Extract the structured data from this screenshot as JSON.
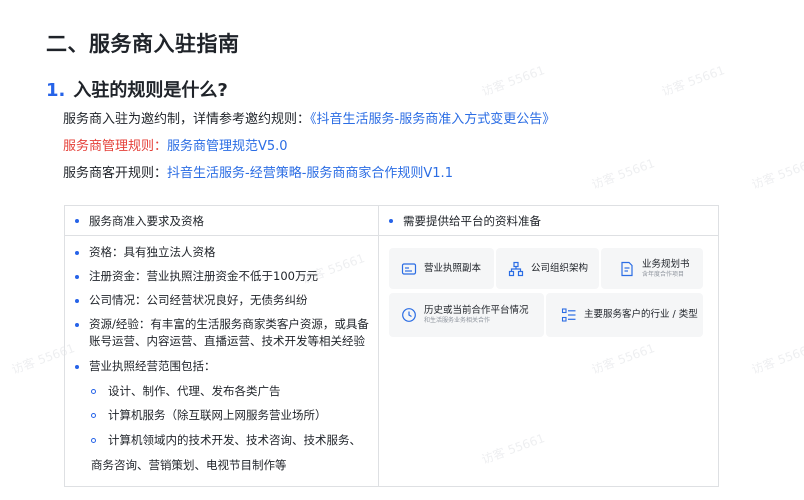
{
  "section_title": "二、服务商入驻指南",
  "question": {
    "number": "1.",
    "text": "入驻的规则是什么?"
  },
  "rules": {
    "invite": {
      "prefix": "服务商入驻为邀约制，详情参考邀约规则：",
      "link": "《抖音生活服务-服务商准入方式变更公告》"
    },
    "manage": {
      "prefix": "服务商管理规则：",
      "link": "服务商管理规范V5.0"
    },
    "guest": {
      "prefix": "服务商客开规则：",
      "link": "抖音生活服务-经营策略-服务商商家合作规则V1.1"
    }
  },
  "table": {
    "left_header": "服务商准入要求及资格",
    "right_header": "需要提供给平台的资料准备",
    "requirements": [
      "资格：具有独立法人资格",
      "注册资金：营业执照注册资金不低于100万元",
      "公司情况：公司经营状况良好，无债务纠纷",
      "资源/经验：有丰富的生活服务商家类客户资源，或具备账号运营、内容运营、直播运营、技术开发等相关经验",
      "营业执照经营范围包括："
    ],
    "scope": [
      "设计、制作、代理、发布各类广告",
      "计算机服务（除互联网上网服务营业场所）",
      "计算机领域内的技术开发、技术咨询、技术服务、"
    ],
    "scope_continued": "商务咨询、营销策划、电视节目制作等",
    "materials": [
      {
        "title": "营业执照副本",
        "icon": "license-icon"
      },
      {
        "title": "公司组织架构",
        "icon": "org-chart-icon"
      },
      {
        "title": "业务规划书",
        "subtitle": "含年度合作项目",
        "icon": "plan-document-icon"
      },
      {
        "title": "历史或当前合作平台情况",
        "subtitle": "和生活服务业务相关合作",
        "icon": "history-clock-icon"
      },
      {
        "title": "主要服务客户的行业 / 类型",
        "icon": "list-icon"
      }
    ]
  },
  "watermark": "访客 55661",
  "colors": {
    "accent": "#2663e8",
    "link": "#2b6de4",
    "red": "#e5413a"
  }
}
